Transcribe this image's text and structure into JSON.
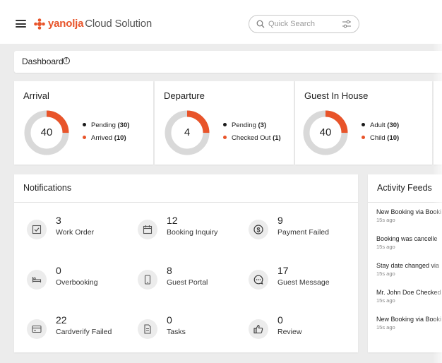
{
  "brand": {
    "logo_text": "yanolja",
    "logo_subtext": "Cloud Solution",
    "accent": "#e8542a"
  },
  "search": {
    "placeholder": "Quick Search"
  },
  "dashboard": {
    "title": "Dashboard"
  },
  "stats": [
    {
      "title": "Arrival",
      "value": "40",
      "fraction": 0.25,
      "legend": [
        {
          "label": "Pending",
          "count": "(30)",
          "color": "#1a1a1a"
        },
        {
          "label": "Arrived",
          "count": "(10)",
          "color": "#e8542a"
        }
      ]
    },
    {
      "title": "Departure",
      "value": "4",
      "fraction": 0.25,
      "legend": [
        {
          "label": "Pending",
          "count": "(3)",
          "color": "#1a1a1a"
        },
        {
          "label": "Checked Out",
          "count": "(1)",
          "color": "#e8542a"
        }
      ]
    },
    {
      "title": "Guest In House",
      "value": "40",
      "fraction": 0.25,
      "legend": [
        {
          "label": "Adult",
          "count": "(30)",
          "color": "#1a1a1a"
        },
        {
          "label": "Child",
          "count": "(10)",
          "color": "#e8542a"
        }
      ]
    }
  ],
  "notifications": {
    "title": "Notifications",
    "items": [
      {
        "count": "3",
        "label": "Work Order",
        "icon": "checkbox-icon"
      },
      {
        "count": "12",
        "label": "Booking Inquiry",
        "icon": "calendar-icon"
      },
      {
        "count": "9",
        "label": "Payment Failed",
        "icon": "dollar-icon"
      },
      {
        "count": "0",
        "label": "Overbooking",
        "icon": "bed-icon"
      },
      {
        "count": "8",
        "label": "Guest Portal",
        "icon": "phone-icon"
      },
      {
        "count": "17",
        "label": "Guest Message",
        "icon": "chat-icon"
      },
      {
        "count": "22",
        "label": "Cardverify Failed",
        "icon": "card-icon"
      },
      {
        "count": "0",
        "label": "Tasks",
        "icon": "document-icon"
      },
      {
        "count": "0",
        "label": "Review",
        "icon": "thumbs-up-icon"
      }
    ]
  },
  "activity": {
    "title": "Activity Feeds",
    "items": [
      {
        "text": "New Booking via Booki",
        "time": "15s ago"
      },
      {
        "text": "Booking was cancelle",
        "time": "15s ago"
      },
      {
        "text": "Stay date changed via",
        "time": "15s ago"
      },
      {
        "text": "Mr. John Doe Checked",
        "time": "15s ago"
      },
      {
        "text": "New Booking via Booki",
        "time": "15s ago"
      }
    ]
  },
  "colors": {
    "donut_track": "#d9d9d9",
    "donut_fill": "#e8542a",
    "background": "#ececec"
  }
}
